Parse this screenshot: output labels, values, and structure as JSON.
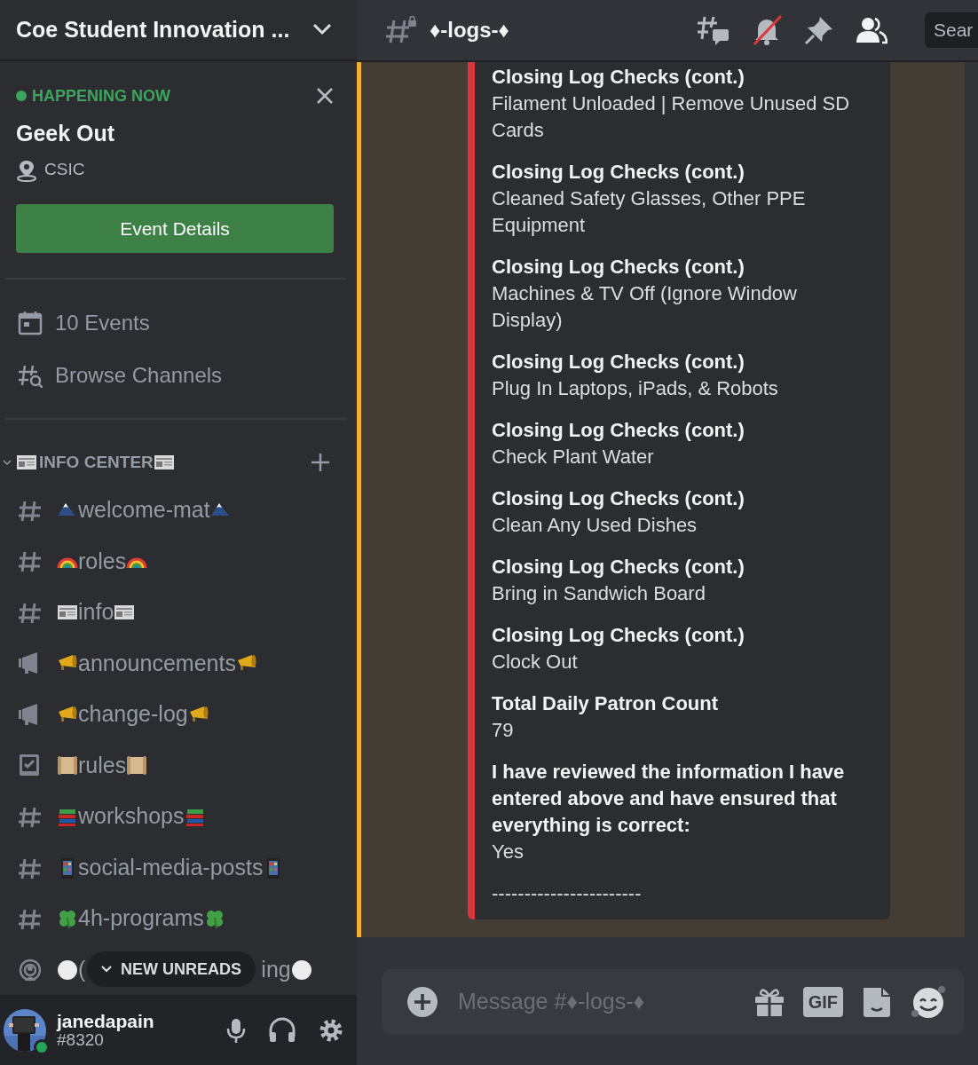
{
  "server": {
    "name": "Coe Student Innovation ..."
  },
  "event": {
    "status": "HAPPENING NOW",
    "title": "Geek Out",
    "location": "CSIC",
    "button": "Event Details"
  },
  "nav_items": [
    {
      "kind": "events",
      "label": "10 Events"
    },
    {
      "kind": "browse",
      "label": "Browse Channels"
    }
  ],
  "category": {
    "label": "INFO CENTER",
    "emoji": {
      "kind": "newspaper"
    },
    "expanded": true
  },
  "channels": [
    {
      "kind": "text",
      "emoji": {
        "kind": "mountain"
      },
      "name": "welcome-mat"
    },
    {
      "kind": "text",
      "emoji": {
        "kind": "rainbow"
      },
      "name": "roles"
    },
    {
      "kind": "text",
      "emoji": {
        "kind": "newspaper"
      },
      "name": "info"
    },
    {
      "kind": "announcement",
      "emoji": {
        "kind": "megaphone"
      },
      "name": "announcements"
    },
    {
      "kind": "announcement",
      "emoji": {
        "kind": "megaphone"
      },
      "name": "change-log"
    },
    {
      "kind": "rules",
      "emoji": {
        "kind": "scroll"
      },
      "name": "rules"
    },
    {
      "kind": "text",
      "emoji": {
        "kind": "books"
      },
      "name": "workshops"
    },
    {
      "kind": "text",
      "emoji": {
        "kind": "phone"
      },
      "name": "social-media-posts"
    },
    {
      "kind": "text",
      "emoji": {
        "kind": "clover"
      },
      "name": "4h-programs"
    },
    {
      "kind": "stage",
      "emoji": {
        "kind": "circle"
      },
      "name_start": "(",
      "name_end": "ing"
    }
  ],
  "new_unreads": "NEW UNREADS",
  "user": {
    "name": "janedapain",
    "tag": "#8320"
  },
  "channel_header": {
    "name": "♦-logs-♦",
    "search_placeholder": "Sear"
  },
  "embed": {
    "fields": [
      {
        "name": "Closing Log Checks (cont.)",
        "value": "Filament Unloaded | Remove Unused SD Cards"
      },
      {
        "name": "Closing Log Checks (cont.)",
        "value": "Cleaned Safety Glasses, Other PPE Equipment"
      },
      {
        "name": "Closing Log Checks (cont.)",
        "value": "Machines & TV Off (Ignore Window Display)"
      },
      {
        "name": "Closing Log Checks (cont.)",
        "value": "Plug In Laptops, iPads, & Robots"
      },
      {
        "name": "Closing Log Checks (cont.)",
        "value": "Check Plant Water"
      },
      {
        "name": "Closing Log Checks (cont.)",
        "value": "Clean Any Used Dishes"
      },
      {
        "name": "Closing Log Checks (cont.)",
        "value": "Bring in Sandwich Board"
      },
      {
        "name": "Closing Log Checks (cont.)",
        "value": "Clock Out"
      },
      {
        "name": "Total Daily Patron Count",
        "value": "79"
      },
      {
        "name": "I have reviewed the information I have entered above and have ensured that everything is correct:",
        "value": "Yes"
      },
      {
        "value": "-----------------------"
      }
    ]
  },
  "composer": {
    "placeholder": "Message #♦-logs-♦",
    "gif_label": "GIF"
  }
}
